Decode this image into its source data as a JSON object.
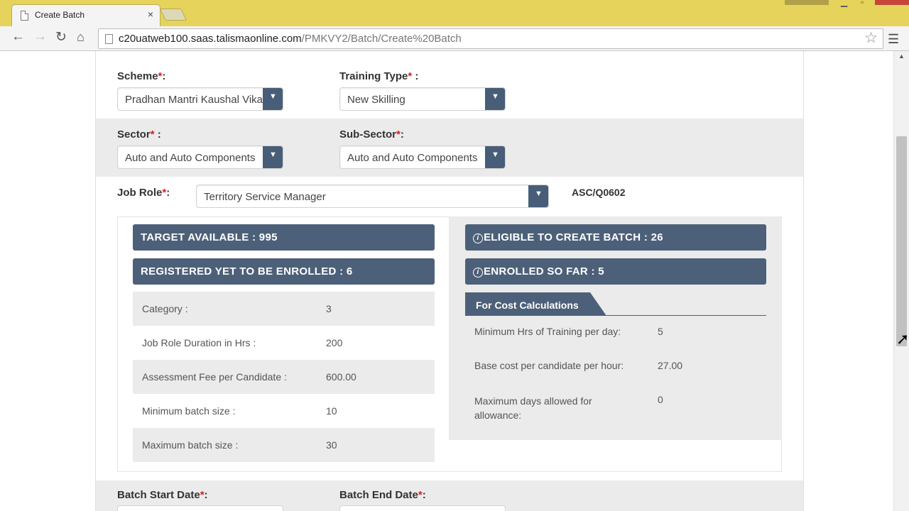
{
  "browser": {
    "tab_title": "Create Batch",
    "tab_close": "×",
    "url_host": "c20uatweb100.saas.talismaonline.com",
    "url_path": "/PMKVY2/Batch/Create%20Batch",
    "icons": [
      "page-icon",
      "close-icon",
      "back-icon",
      "forward-icon",
      "reload-icon",
      "home-icon",
      "star-icon",
      "menu-icon"
    ]
  },
  "form": {
    "required_mark": "*",
    "scheme": {
      "label": "Scheme",
      "suffix": ":",
      "value": "Pradhan Mantri Kaushal Vikas Yojana"
    },
    "training_type": {
      "label": "Training Type",
      "suffix": " :",
      "value": "New Skilling"
    },
    "sector": {
      "label": "Sector",
      "suffix": " :",
      "value": "Auto and Auto Components"
    },
    "sub_sector": {
      "label": "Sub-Sector",
      "suffix": ":",
      "value": "Auto and Auto Components"
    },
    "job_role": {
      "label": "Job Role",
      "suffix": ":",
      "value": "Territory Service Manager",
      "code": "ASC/Q0602"
    },
    "batch_start": {
      "label": "Batch Start Date",
      "suffix": ":"
    },
    "batch_end": {
      "label": "Batch End Date",
      "suffix": ":"
    }
  },
  "stats": {
    "target_available": "TARGET AVAILABLE : 995",
    "registered": "REGISTERED YET TO BE ENROLLED : 6",
    "eligible": "ELIGIBLE TO CREATE BATCH : 26",
    "enrolled": "ENROLLED SO FAR : 5",
    "info_glyph": "i"
  },
  "details": [
    {
      "key": "Category :",
      "value": "3"
    },
    {
      "key": "Job Role Duration in Hrs :",
      "value": "200"
    },
    {
      "key": "Assessment Fee per Candidate :",
      "value": "600.00"
    },
    {
      "key": "Minimum batch size :",
      "value": "10"
    },
    {
      "key": "Maximum batch size :",
      "value": "30"
    }
  ],
  "cost": {
    "title": "For Cost Calculations",
    "rows": [
      {
        "key": "Minimum Hrs of Training per day:",
        "value": "5"
      },
      {
        "key": "Base cost per candidate per hour:",
        "value": "27.00"
      },
      {
        "key": "Maximum days allowed for allowance:",
        "value": "0"
      }
    ]
  },
  "colors": {
    "accent": "#4d6079",
    "required": "#e0191e",
    "chrome": "#e5d35b"
  }
}
